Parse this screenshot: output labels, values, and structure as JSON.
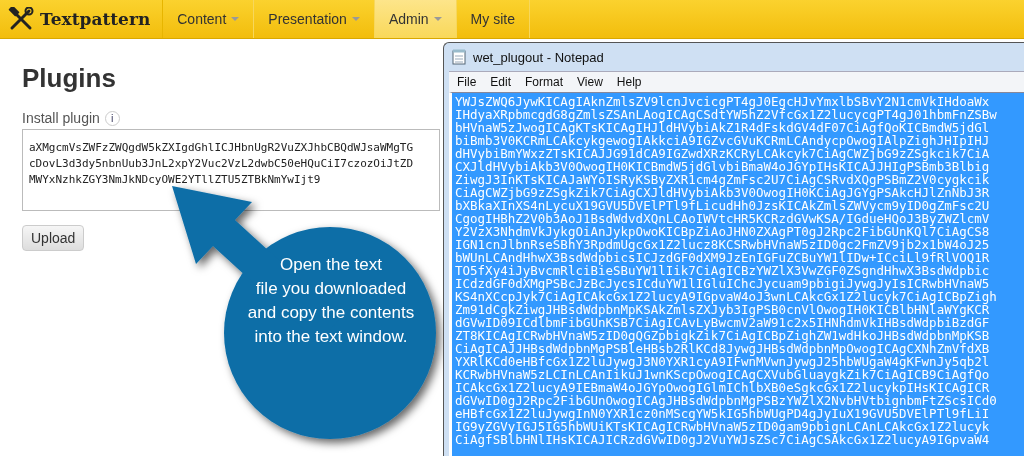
{
  "app": {
    "logo": "Textpattern",
    "nav": [
      {
        "label": "Content",
        "dropdown": true,
        "selected": false
      },
      {
        "label": "Presentation",
        "dropdown": true,
        "selected": false
      },
      {
        "label": "Admin",
        "dropdown": true,
        "selected": true
      },
      {
        "label": "My site",
        "dropdown": false,
        "selected": false
      }
    ]
  },
  "page": {
    "title": "Plugins",
    "install_label": "Install plugin",
    "info": "i",
    "code_lines": [
      "aXMgcmVsZWFzZWQgdW5kZXIgdGhlICJHbnUgR2VuZXJhbCBQdWJsaWMgTG",
      "cDovL3d3dy5nbnUub3JnL2xpY2Vuc2VzL2dwbC50eHQuCiI7czozOiJtZD",
      "MWYxNzhkZGY3NmJkNDcyOWE2YTllZTU5ZTBkNmYwIjt9"
    ],
    "upload_button": "Upload"
  },
  "notepad": {
    "title": "wet_plugout - Notepad",
    "menu": [
      "File",
      "Edit",
      "Format",
      "View",
      "Help"
    ],
    "lines": [
      "YWJsZWQ6JywKICAgIAknZmlsZV9lcnJvcicgPT4gJ0EgcHJvYmxlbSBvY2N1cmVkIHdoaWx",
      "IHdyaXRpbmcgdG8gZmlsZSAnLAogICAgCSdtYW5hZ2VfcGx1Z2lucycgPT4gJ01hbmFnZSBw",
      "bHVnaW5zJwogICAgKTsKICAgIHJldHVybiAkZ1R4dFskdGV4dF07CiAgfQoKICBmdW5jdGl",
      "biBmb3V0KCRmLCAkcykgewogIAkkciA9IGZvcGVuKCRmLCAndycpOwogIAlpZighJHIpIHJ",
      "dHVybiBmYWxzZTsKICAJJG91dCA9IGZwdXRzKCRyLCAkcyk7CiAgCWZjbG9zZSgkcik7CiA",
      "CXJldHVybiAkb3V0OwogIH0KICBmdW5jdGlvbiBmaW4oJGYpIHsKICAJJHIgPSBmb3Blbig",
      "ZiwgJ3InKTsKICAJaWYoISRyKSByZXR1cm4gZmFsc2U7CiAgCSRvdXQgPSBmZ2V0cygkcik",
      "CiAgCWZjbG9zZSgkZik7CiAgCXJldHVybiAkb3V0OwogIH0KCiAgJGYgPSAkcHJlZnNbJ3R",
      "bXBkaXInXS4nLycuX19GVU5DVElPTl9fLicudHh0JzsKICAkZmlsZWVycm9yID0gZmFsc2U",
      "CgogIHBhZ2V0b3AoJ1BsdWdvdXQnLCAoIWVtcHR5KCRzdGVwKSA/IGdueHQoJ3ByZWZlcmV",
      "Y2VzX3NhdmVkJykgOiAnJykpOwoKICBpZiAoJHN0ZXAgPT0gJ2Rpc2FibGUnKQl7CiAgCS8",
      "IGN1cnJlbnRseSBhY3RpdmUgcGx1Z2lucz8KCSRwbHVnaW5zID0gc2FmZV9jb2x1bW4oJ25",
      "bWUnLCAndHhwX3BsdWdpbicsICJzdGF0dXM9JzEnIGFuZCBuYW1lIDw+ICciLl9fRlVOQ1R",
      "TO5fXy4iJyBvcmRlciBieSBuYW1lIik7CiAgICBzYWZlX3VwZGF0ZSgndHhwX3BsdWdpbic",
      "ICdzdGF0dXMgPSBcJzBcJycsICduYW1lIGluIChcJycuam9pbigiJywgJyIsICRwbHVnaW5",
      "KS4nXCcpJyk7CiAgICAkcGx1Z2lucyA9IGpvaW4oJ3wnLCAkcGx1Z2lucyk7CiAgICBpZigh",
      "Zm91dCgkZiwgJHBsdWdpbnMpKSAkZmlsZXJyb3IgPSB0cnVlOwogIH0KICBlbHNlaWYgKCR",
      "dGVwID09ICdlbmFibGUnKSB7CiAgICAvLyBwcmV2aW91c2x5IHNhdmVkIHBsdWdpbiBzdGF",
      "ZT8KICAgICRwbHVnaW5zID0gQGZpbigkZik7CiAgICBpZighZW1wdHkoJHBsdWdpbnMpKSB",
      "CiAgICAJJHBsdWdpbnMgPSBleHBsb2RlKCd8JywgJHBsdWdpbnMpOwogICAgCXNhZmVfdXB",
      "YXRlKCd0eHBfcGx1Z2luJywgJ3N0YXR1cyA9IFwnMVwnJywgJ25hbWUgaW4gKFwnJy5qb2l",
      "KCRwbHVnaW5zLCInLCAnIikuJ1wnKScpOwogICAgCXVubGluaygkZik7CiAgICB9CiAgfQo",
      "ICAkcGx1Z2lucyA9IEBmaW4oJGYpOwogIGlmIChlbXB0eSgkcGx1Z2lucykpIHsKICAgICR",
      "dGVwID0gJ2Rpc2FibGUnOwogICAgJHBsdWdpbnMgPSBzYWZlX2NvbHVtbignbmFtZScsICd0",
      "eHBfcGx1Z2luJywgInN0YXR1cz0nMScgYW5kIG5hbWUgPD4gJyIuX19GVU5DVElPTl9fLiI",
      "IG9yZGVyIGJ5IG5hbWUiKTsKICAgICRwbHVnaW5zID0gam9pbignLCAnLCAkcGx1Z2lucyk",
      "CiAgfSBlbHNlIHsKICAJICRzdGVwID0gJ2VuYWJsZSc7CiAgCSAkcGx1Z2lucyA9IGpvaW4"
    ]
  },
  "callout": {
    "text": "Open the text\nfile you downloaded\nand copy the contents\ninto the text window."
  }
}
